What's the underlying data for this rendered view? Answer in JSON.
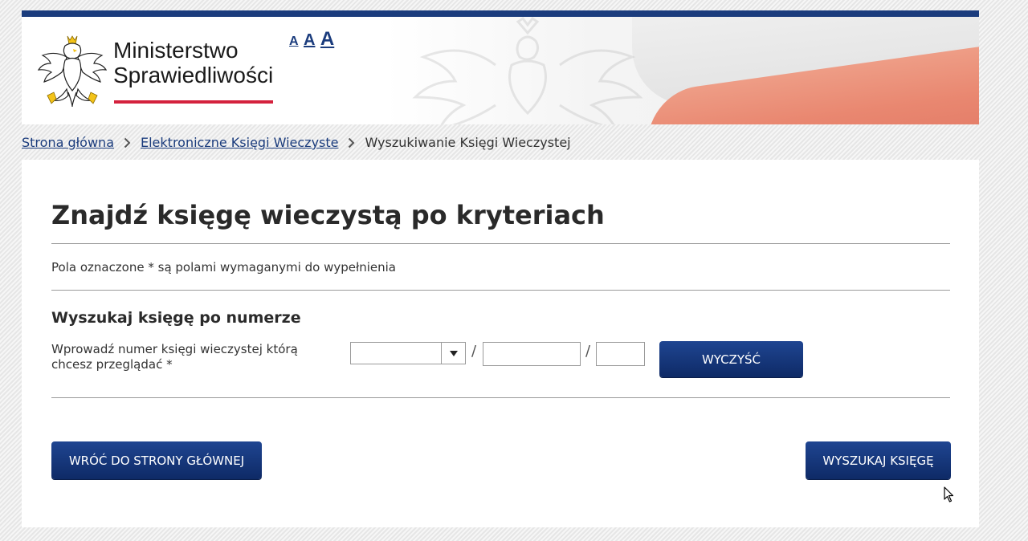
{
  "header": {
    "logo_line1": "Ministerstwo",
    "logo_line2": "Sprawiedliwości",
    "font_size_small": "A",
    "font_size_medium": "A",
    "font_size_large": "A"
  },
  "breadcrumb": {
    "home": "Strona główna",
    "ekw": "Elektroniczne Księgi Wieczyste",
    "current": "Wyszukiwanie Księgi Wieczystej"
  },
  "main": {
    "title": "Znajdź księgę wieczystą po kryteriach",
    "required_note": "Pola oznaczone * są polami wymaganymi do wypełnienia",
    "section_title": "Wyszukaj księgę po numerze",
    "field_label": "Wprowadź numer księgi wieczystej którą chcesz przeglądać *",
    "court_code_value": "",
    "number_value": "",
    "check_digit_value": "",
    "separator": "/",
    "clear_button": "WYCZYŚĆ",
    "back_button": "WRÓĆ DO STRONY GŁÓWNEJ",
    "search_button": "WYSZUKAJ KSIĘGĘ"
  },
  "colors": {
    "navy": "#1b3c7d",
    "button_top": "#1f4591",
    "button_bottom": "#0e2a66",
    "flag_red": "#e98770",
    "stripe_red": "#d4213d"
  },
  "icons": [
    "polish-eagle-emblem-icon",
    "eagle-watermark-icon",
    "chevron-right-icon",
    "caret-down-icon",
    "mouse-cursor-icon"
  ]
}
